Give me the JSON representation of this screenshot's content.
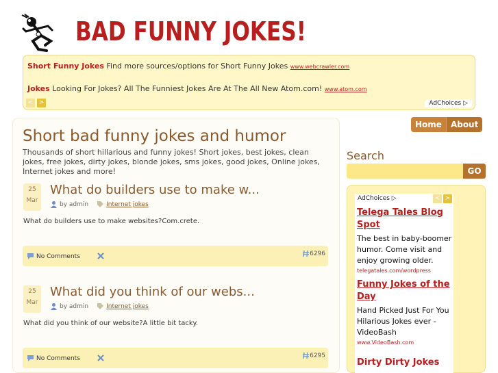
{
  "logo": {
    "text": "BAD FUNNY JOKES!"
  },
  "top_ad": {
    "items": [
      {
        "title": "Short Funny Jokes",
        "text": "Find more sources/options for Short Funny Jokes",
        "url": "www.webcrawler.com"
      },
      {
        "title": "Jokes",
        "text": "Looking For Jokes? All The Funniest Jokes Are At The All New Atom.com!",
        "url": "www.atom.com"
      }
    ],
    "prev": "<",
    "next": ">",
    "adchoices": "AdChoices ▷"
  },
  "page": {
    "title": "Short bad funny jokes and humor",
    "intro": "Thousands of short hillarious and funny jokes! Short jokes, best jokes, clean jokes, free jokes, dirty jokes, blonde jokes, sms jokes, good jokes, Online jokes, Internet jokes and more!"
  },
  "posts": [
    {
      "day": "25",
      "month": "Mar",
      "title": "What do builders use to make w...",
      "author": "by admin",
      "category": "Internet jokes",
      "body": "What do builders use to make websites?Com.crete.",
      "comments": "No Comments",
      "id": "6296"
    },
    {
      "day": "25",
      "month": "Mar",
      "title": "What did you think of our webs...",
      "author": "by admin",
      "category": "Internet jokes",
      "body": "What did you think of our website?A little bit tacky.",
      "comments": "No Comments",
      "id": "6295"
    }
  ],
  "nav": {
    "home": "Home",
    "about": "About"
  },
  "search": {
    "label": "Search",
    "go": "GO",
    "value": ""
  },
  "side_ad": {
    "adchoices": "AdChoices ▷",
    "prev": "<",
    "next": ">",
    "items": [
      {
        "title": "Telega Tales Blog Spot",
        "desc": "The best in baby-boomer humor. Come visit and enjoy growing older.",
        "url": "telegatales.com/wordpress"
      },
      {
        "title": "Funny Jokes of the Day",
        "desc": "Hand Picked Just For You Hilarious Jokes ever - VideoBash",
        "url": "www.VideoBash.com"
      },
      {
        "title": "Dirty Dirty Jokes",
        "desc": "",
        "url": ""
      }
    ]
  },
  "colors": {
    "accent": "#b71f1f",
    "brown": "#8a5a2f",
    "tab": "#b5722d",
    "yellow": "#fff7c8"
  }
}
